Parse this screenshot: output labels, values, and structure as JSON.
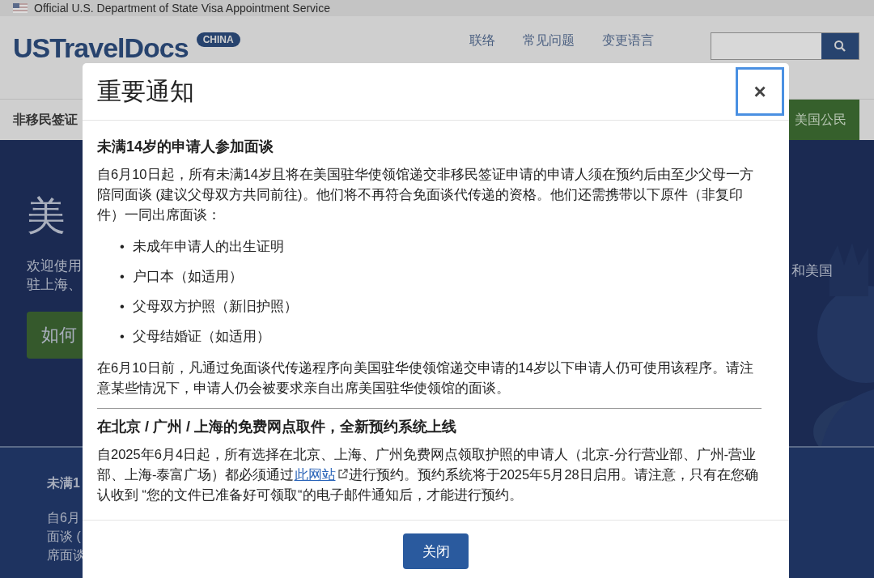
{
  "banner": {
    "text": "Official U.S. Department of State Visa Appointment Service"
  },
  "header": {
    "logo": "USTravelDocs",
    "logo_badge": "CHINA",
    "nav_links": [
      "联络",
      "常见问题",
      "变更语言"
    ]
  },
  "main_nav": [
    {
      "label": "非移民签证",
      "selected": false
    },
    {
      "label": "美国公民",
      "selected": true
    }
  ],
  "hero": {
    "title": "美",
    "intro_left": [
      "欢迎使用",
      "驻上海、"
    ],
    "intro_right": "和美国",
    "button": "如何"
  },
  "notice_preview": {
    "heading": "未满1",
    "lines": [
      "自6月",
      "面谈 (",
      "席面谈"
    ]
  },
  "modal": {
    "title": "重要通知",
    "close_glyph": "×",
    "sections": [
      {
        "heading": "未满14岁的申请人参加面谈",
        "blocks": [
          {
            "kind": "paragraph",
            "parts": [
              {
                "text": "自6月10日起，所有未满14岁且将在美国驻华使领馆递交非移民签证申请的申请人须在预约后由至少父母一方陪同面谈 (建议父母双方共同前往)。他们将不再符合免面谈代传递的资格。他们还需携带以下原件（非复印件）一同出席面谈：",
                "link": false
              }
            ]
          },
          {
            "kind": "list",
            "bullet": "•",
            "items": [
              "未成年申请人的出生证明",
              "户口本（如适用）",
              "父母双方护照（新旧护照）",
              "父母结婚证（如适用）"
            ]
          },
          {
            "kind": "paragraph",
            "parts": [
              {
                "text": "在6月10日前，凡通过免面谈代传递程序向美国驻华使领馆递交申请的14岁以下申请人仍可使用该程序。请注意某些情况下，申请人仍会被要求亲自出席美国驻华使领馆的面谈。",
                "link": false
              }
            ]
          }
        ]
      },
      {
        "heading": "在北京 / 广州 / 上海的免费网点取件，全新预约系统上线",
        "blocks": [
          {
            "kind": "paragraph",
            "parts": [
              {
                "text": "自2025年6月4日起，所有选择在北京、上海、广州免费网点领取护照的申请人（北京-分行营业部、广州-营业部、上海-泰富广场）都必须通过",
                "link": false
              },
              {
                "text": "此网站",
                "link": true
              },
              {
                "text": "进行预约。预约系统将于2025年5月28日启用。请注意，只有在您确认收到 “您的文件已准备好可领取“的电子邮件通知后，才能进行预约。",
                "link": false
              }
            ]
          }
        ]
      }
    ],
    "button": "关闭"
  }
}
